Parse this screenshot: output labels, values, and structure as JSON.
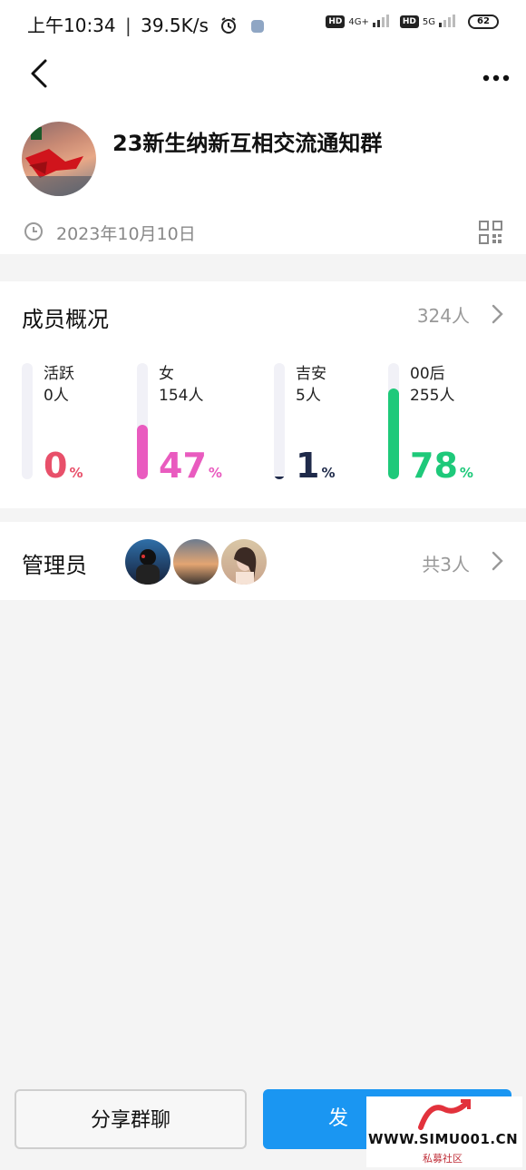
{
  "status_bar": {
    "time": "上午10:34",
    "speed": "39.5K/s",
    "hd1": "HD",
    "net1": "4G+",
    "hd2": "HD",
    "net2": "5G",
    "battery": "62"
  },
  "group": {
    "name": "23新生纳新互相交流通知群",
    "created_date": "2023年10月10日"
  },
  "overview": {
    "title": "成员概况",
    "total": "324人",
    "stats": [
      {
        "label": "活跃",
        "count": "0人",
        "percent": 0,
        "percent_text": "0",
        "color": "#e8506a"
      },
      {
        "label": "女",
        "count": "154人",
        "percent": 47,
        "percent_text": "47",
        "color": "#e95bbf"
      },
      {
        "label": "吉安",
        "count": "5人",
        "percent": 1,
        "percent_text": "1",
        "color": "#1f2a4a"
      },
      {
        "label": "00后",
        "count": "255人",
        "percent": 78,
        "percent_text": "78",
        "color": "#1ec97a"
      }
    ],
    "percent_sign": "%"
  },
  "admins": {
    "title": "管理员",
    "count": "共3人"
  },
  "actions": {
    "share": "分享群聊",
    "send": "发"
  },
  "watermark": {
    "site": "WWW.SIMU001.CN",
    "caption": "私募社区"
  }
}
